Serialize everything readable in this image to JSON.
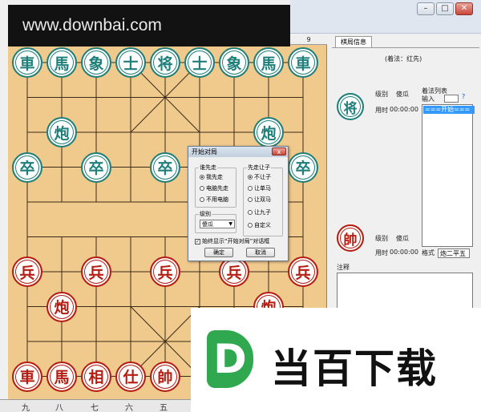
{
  "watermark": {
    "text": "www.downbai.com"
  },
  "board": {
    "column_header": "9",
    "bottom_labels": [
      "九",
      "八",
      "七",
      "六",
      "五"
    ],
    "pieces": {
      "black_top_row": [
        "車",
        "馬",
        "象",
        "士",
        "将",
        "士",
        "象",
        "馬",
        "車"
      ],
      "black_cannons": [
        "炮",
        "炮"
      ],
      "black_soldiers": [
        "卒",
        "卒",
        "卒",
        "卒",
        "卒"
      ],
      "red_soldiers": [
        "兵",
        "兵",
        "兵",
        "兵",
        "兵"
      ],
      "red_cannons": [
        "炮",
        "炮"
      ],
      "red_bottom_row": [
        "車",
        "馬",
        "相",
        "仕",
        "帥"
      ]
    }
  },
  "right_panel": {
    "tab_label": "棋局信息",
    "first_move": "(着法：红先)",
    "top_side": {
      "piece": "将",
      "level_label": "级别",
      "level_value": "傻瓜",
      "time_label": "用时",
      "time_value": "00:00:00"
    },
    "bottom_side": {
      "piece": "帥",
      "level_label": "级别",
      "level_value": "傻瓜",
      "time_label": "用时",
      "time_value": "00:00:00"
    },
    "moves_group_label": "着法列表",
    "input_label": "输入",
    "input_hint": "?",
    "moves_selected": "===开始===",
    "format_label": "格式",
    "format_value": "炮二平五",
    "notes_label": "注释"
  },
  "dialog": {
    "title": "开始对局",
    "close": "x",
    "first_group": {
      "label": "谁先走",
      "options": [
        "我先走",
        "电脑先走",
        "不用电脑"
      ],
      "selected": 0
    },
    "handicap_group": {
      "label": "先走让子",
      "options": [
        "不让子",
        "让单马",
        "让双马",
        "让九子",
        "自定义"
      ],
      "selected": 0
    },
    "level_group": {
      "label": "级别",
      "value": "傻瓜"
    },
    "always_show": "始终显示“开始对局”对话框",
    "ok": "确定",
    "cancel": "取消"
  },
  "overlay_logo": {
    "letter": "D",
    "text": "当百下载",
    "color": "#2fa84f"
  }
}
